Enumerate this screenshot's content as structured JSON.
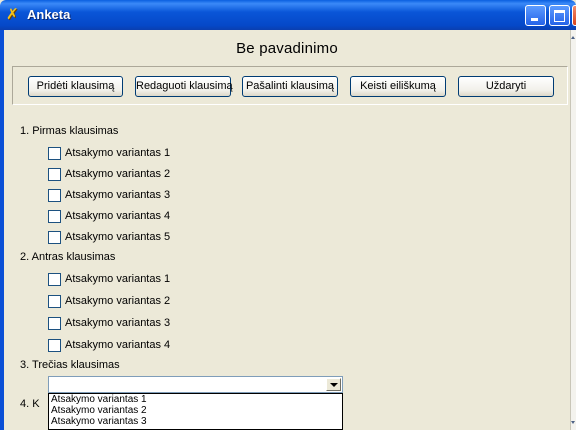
{
  "window": {
    "title": "Anketa",
    "app_icon": "anketa-app-icon",
    "controls": [
      "minimize-icon",
      "maximize-icon",
      "close-icon"
    ]
  },
  "form_title": "Be pavadinimo",
  "toolbar": {
    "add_label": "Pridėti klausimą",
    "edit_label": "Redaguoti klausimą",
    "delete_label": "Pašalinti klausimą",
    "reorder_label": "Keisti eiliškumą",
    "close_label": "Uždaryti"
  },
  "questions": [
    {
      "label": "1. Pirmas klausimas",
      "options": [
        "Atsakymo variantas 1",
        "Atsakymo variantas 2",
        "Atsakymo variantas 3",
        "Atsakymo variantas 4",
        "Atsakymo variantas 5"
      ]
    },
    {
      "label": "2. Antras klausimas",
      "options": [
        "Atsakymo variantas 1",
        "Atsakymo variantas 2",
        "Atsakymo variantas 3",
        "Atsakymo variantas 4"
      ]
    },
    {
      "label": "3. Trečias klausimas",
      "combo_value": "",
      "dropdown_options": [
        "Atsakymo variantas 1",
        "Atsakymo variantas 2",
        "Atsakymo variantas 3"
      ]
    },
    {
      "label": "4. K"
    }
  ],
  "colors": {
    "titlebar": "#0a56d8",
    "window_bg": "#ece9d8",
    "button_border": "#003c74"
  }
}
